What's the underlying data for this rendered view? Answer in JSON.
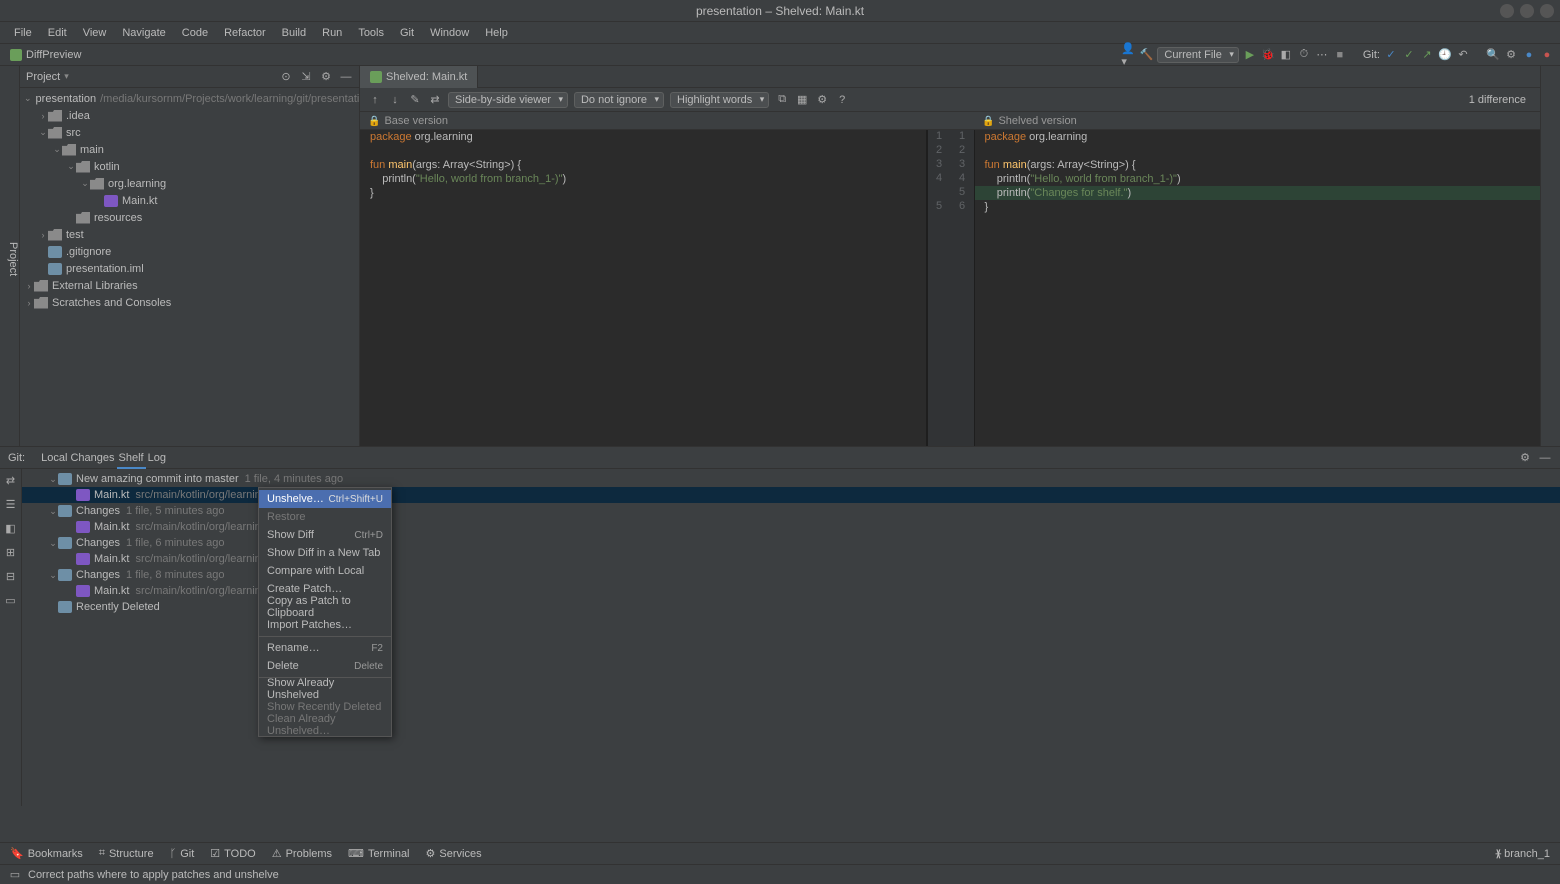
{
  "window": {
    "title": "presentation – Shelved: Main.kt"
  },
  "menubar": [
    "File",
    "Edit",
    "View",
    "Navigate",
    "Code",
    "Refactor",
    "Build",
    "Run",
    "Tools",
    "Git",
    "Window",
    "Help"
  ],
  "toolbar": {
    "diff_preview": "DiffPreview",
    "current_file": "Current File",
    "git_label": "Git:"
  },
  "project": {
    "title": "Project",
    "root": {
      "name": "presentation",
      "path": "/media/kursornm/Projects/work/learning/git/presentation"
    },
    "tree": [
      {
        "level": 1,
        "arrow": ">",
        "icon": "folder",
        "label": ".idea"
      },
      {
        "level": 1,
        "arrow": "v",
        "icon": "folder",
        "label": "src"
      },
      {
        "level": 2,
        "arrow": "v",
        "icon": "folder",
        "label": "main"
      },
      {
        "level": 3,
        "arrow": "v",
        "icon": "folder",
        "label": "kotlin"
      },
      {
        "level": 4,
        "arrow": "v",
        "icon": "folder",
        "label": "org.learning"
      },
      {
        "level": 5,
        "arrow": "",
        "icon": "kt",
        "label": "Main.kt"
      },
      {
        "level": 3,
        "arrow": "",
        "icon": "folder",
        "label": "resources"
      },
      {
        "level": 1,
        "arrow": ">",
        "icon": "folder",
        "label": "test"
      },
      {
        "level": 1,
        "arrow": "",
        "icon": "file",
        "label": ".gitignore"
      },
      {
        "level": 1,
        "arrow": "",
        "icon": "file",
        "label": "presentation.iml"
      }
    ],
    "external": "External Libraries",
    "scratches": "Scratches and Consoles"
  },
  "editor": {
    "tab": "Shelved: Main.kt",
    "viewer_mode": "Side-by-side viewer",
    "ignore_mode": "Do not ignore",
    "highlight_mode": "Highlight words",
    "diffcount": "1 difference",
    "left_header": "Base version",
    "right_header": "Shelved version",
    "left_code": [
      {
        "t": [
          {
            "c": "kw",
            "s": "package"
          },
          {
            "c": "",
            "s": " org.learning"
          }
        ]
      },
      {
        "t": []
      },
      {
        "t": [
          {
            "c": "kw",
            "s": "fun "
          },
          {
            "c": "fn",
            "s": "main"
          },
          {
            "c": "",
            "s": "(args: Array<String>) {"
          }
        ]
      },
      {
        "t": [
          {
            "c": "",
            "s": "    println("
          },
          {
            "c": "str",
            "s": "\"Hello, world from branch_1-)\""
          },
          {
            "c": "",
            "s": ")"
          }
        ]
      },
      {
        "t": [
          {
            "c": "",
            "s": "}"
          }
        ]
      }
    ],
    "right_code": [
      {
        "ln": "1",
        "t": [
          {
            "c": "kw",
            "s": "package"
          },
          {
            "c": "",
            "s": " org.learning"
          }
        ]
      },
      {
        "ln": "2",
        "t": []
      },
      {
        "ln": "3",
        "t": [
          {
            "c": "kw",
            "s": "fun "
          },
          {
            "c": "fn",
            "s": "main"
          },
          {
            "c": "",
            "s": "(args: Array<String>) {"
          }
        ]
      },
      {
        "ln": "4",
        "t": [
          {
            "c": "",
            "s": "    println("
          },
          {
            "c": "str",
            "s": "\"Hello, world from branch_1-)\""
          },
          {
            "c": "",
            "s": ")"
          }
        ]
      },
      {
        "ln": "5",
        "added": true,
        "t": [
          {
            "c": "",
            "s": "    println("
          },
          {
            "c": "str",
            "s": "\"Changes for shelf.\""
          },
          {
            "c": "",
            "s": ")"
          }
        ]
      },
      {
        "ln": "6",
        "t": [
          {
            "c": "",
            "s": "}"
          }
        ]
      }
    ],
    "gutter_pairs": [
      [
        "1",
        "1"
      ],
      [
        "2",
        "2"
      ],
      [
        "3",
        "3"
      ],
      [
        "4",
        "4"
      ],
      [
        "",
        "5"
      ],
      [
        "5",
        "6"
      ]
    ]
  },
  "git": {
    "label": "Git:",
    "tabs": [
      "Local Changes",
      "Shelf",
      "Log"
    ],
    "active_tab": "Shelf",
    "shelf": [
      {
        "level": 0,
        "arrow": "v",
        "label": "New amazing commit into master",
        "meta": "1 file, 4 minutes ago"
      },
      {
        "level": 1,
        "arrow": "",
        "label": "Main.kt",
        "meta": "src/main/kotlin/org/learning",
        "selected": true
      },
      {
        "level": 0,
        "arrow": "v",
        "label": "Changes",
        "meta": "1 file, 5 minutes ago"
      },
      {
        "level": 1,
        "arrow": "",
        "label": "Main.kt",
        "meta": "src/main/kotlin/org/learning"
      },
      {
        "level": 0,
        "arrow": "v",
        "label": "Changes",
        "meta": "1 file, 6 minutes ago"
      },
      {
        "level": 1,
        "arrow": "",
        "label": "Main.kt",
        "meta": "src/main/kotlin/org/learning"
      },
      {
        "level": 0,
        "arrow": "v",
        "label": "Changes",
        "meta": "1 file, 8 minutes ago"
      },
      {
        "level": 1,
        "arrow": "",
        "label": "Main.kt",
        "meta": "src/main/kotlin/org/learning"
      },
      {
        "level": 0,
        "arrow": "",
        "label": "Recently Deleted",
        "meta": ""
      }
    ],
    "context_menu": [
      {
        "label": "Unshelve…",
        "shortcut": "Ctrl+Shift+U",
        "selected": true
      },
      {
        "label": "Restore",
        "disabled": true
      },
      {
        "label": "Show Diff",
        "shortcut": "Ctrl+D"
      },
      {
        "label": "Show Diff in a New Tab"
      },
      {
        "label": "Compare with Local"
      },
      {
        "label": "Create Patch…"
      },
      {
        "label": "Copy as Patch to Clipboard"
      },
      {
        "label": "Import Patches…"
      },
      {
        "sep": true
      },
      {
        "label": "Rename…",
        "shortcut": "F2"
      },
      {
        "label": "Delete",
        "shortcut": "Delete"
      },
      {
        "sep": true
      },
      {
        "label": "Show Already Unshelved"
      },
      {
        "label": "Show Recently Deleted",
        "disabled": true
      },
      {
        "label": "Clean Already Unshelved…",
        "disabled": true
      }
    ]
  },
  "footer": {
    "tabs": [
      "Bookmarks",
      "Structure",
      "Git",
      "TODO",
      "Problems",
      "Terminal",
      "Services"
    ],
    "status": "Correct paths where to apply patches and unshelve",
    "branch": "branch_1"
  }
}
